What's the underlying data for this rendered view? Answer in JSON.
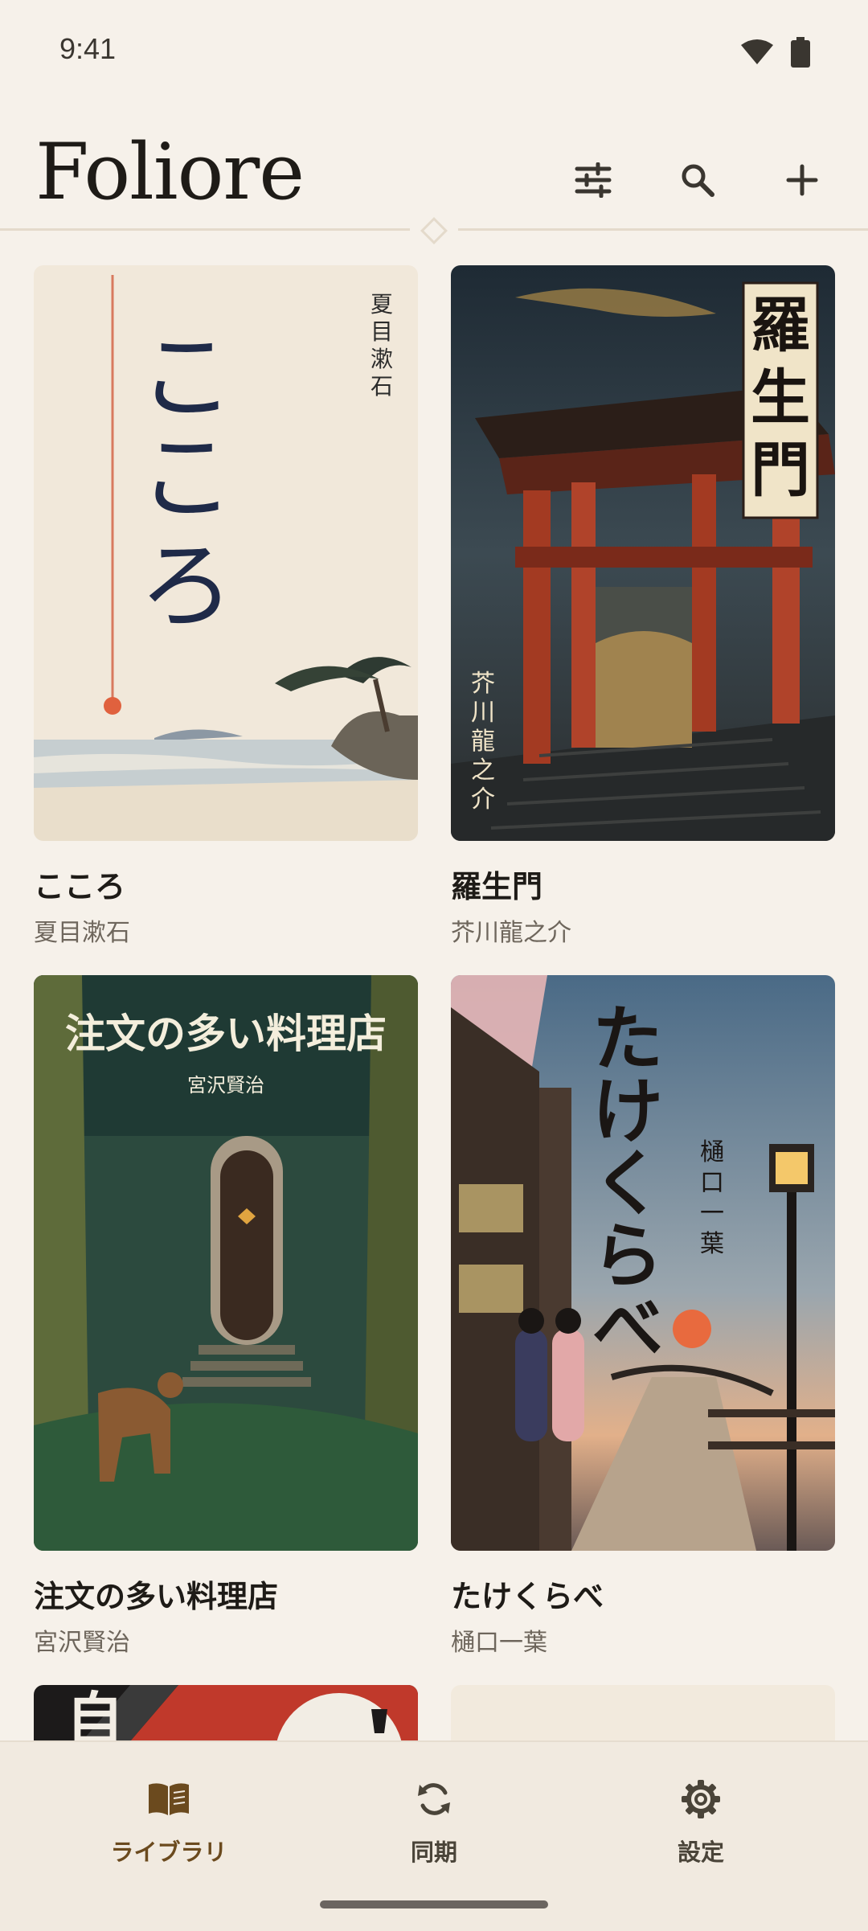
{
  "status": {
    "time": "9:41"
  },
  "app": {
    "title": "Foliore",
    "actions": [
      "filter-icon",
      "search-icon",
      "add-icon"
    ]
  },
  "books": [
    {
      "title": "こころ",
      "author": "夏目漱石",
      "cover_title": "こころ",
      "cover_author": "夏目漱石"
    },
    {
      "title": "羅生門",
      "author": "芥川龍之介",
      "cover_title": "羅生門",
      "cover_author": "芥川龍之介"
    },
    {
      "title": "注文の多い料理店",
      "author": "宮沢賢治",
      "cover_title": "注文の多い料理店",
      "cover_author": "宮沢賢治"
    },
    {
      "title": "たけくらべ",
      "author": "樋口一葉",
      "cover_title": "たけくらべ",
      "cover_author": "樋口一葉"
    },
    {
      "cover_title": "自"
    }
  ],
  "nav": [
    {
      "label": "ライブラリ",
      "icon": "book-icon",
      "active": true
    },
    {
      "label": "同期",
      "icon": "sync-icon",
      "active": false
    },
    {
      "label": "設定",
      "icon": "gear-icon",
      "active": false
    }
  ],
  "colors": {
    "background": "#F6F1EA",
    "accent": "#6B4A1E",
    "nav_background": "#F1EAE0"
  }
}
